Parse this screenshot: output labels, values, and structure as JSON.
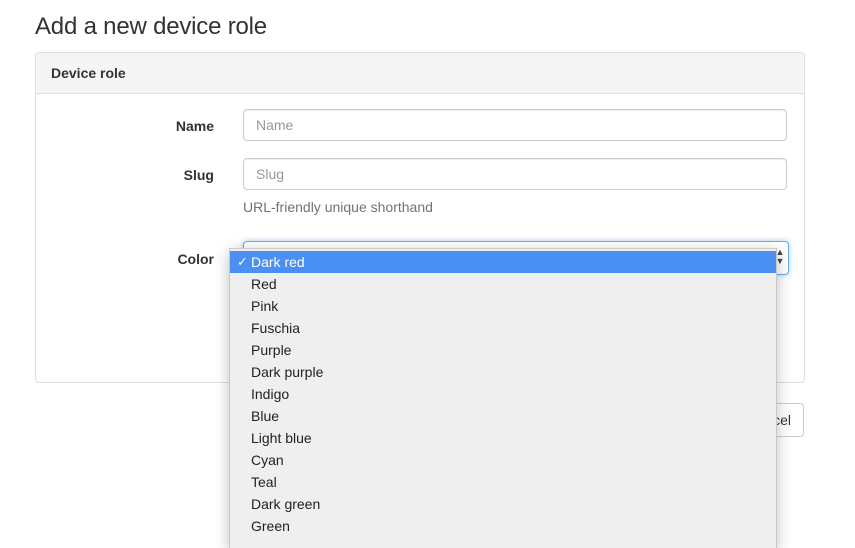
{
  "page": {
    "title": "Add a new device role"
  },
  "panel": {
    "heading": "Device role"
  },
  "form": {
    "name": {
      "label": "Name",
      "placeholder": "Name"
    },
    "slug": {
      "label": "Slug",
      "placeholder": "Slug",
      "help": "URL-friendly unique shorthand"
    },
    "color": {
      "label": "Color",
      "selected": "Dark red",
      "arrows_icon": "updown-arrows-icon"
    }
  },
  "dropdown": {
    "check_mark": "✓",
    "options": [
      "Dark red",
      "Red",
      "Pink",
      "Fuschia",
      "Purple",
      "Dark purple",
      "Indigo",
      "Blue",
      "Light blue",
      "Cyan",
      "Teal",
      "Dark green",
      "Green"
    ]
  },
  "buttons": {
    "cancel_label": "cel"
  },
  "colors": {
    "selected_bg": "#4a90f2",
    "focus_border": "#66afe9"
  }
}
